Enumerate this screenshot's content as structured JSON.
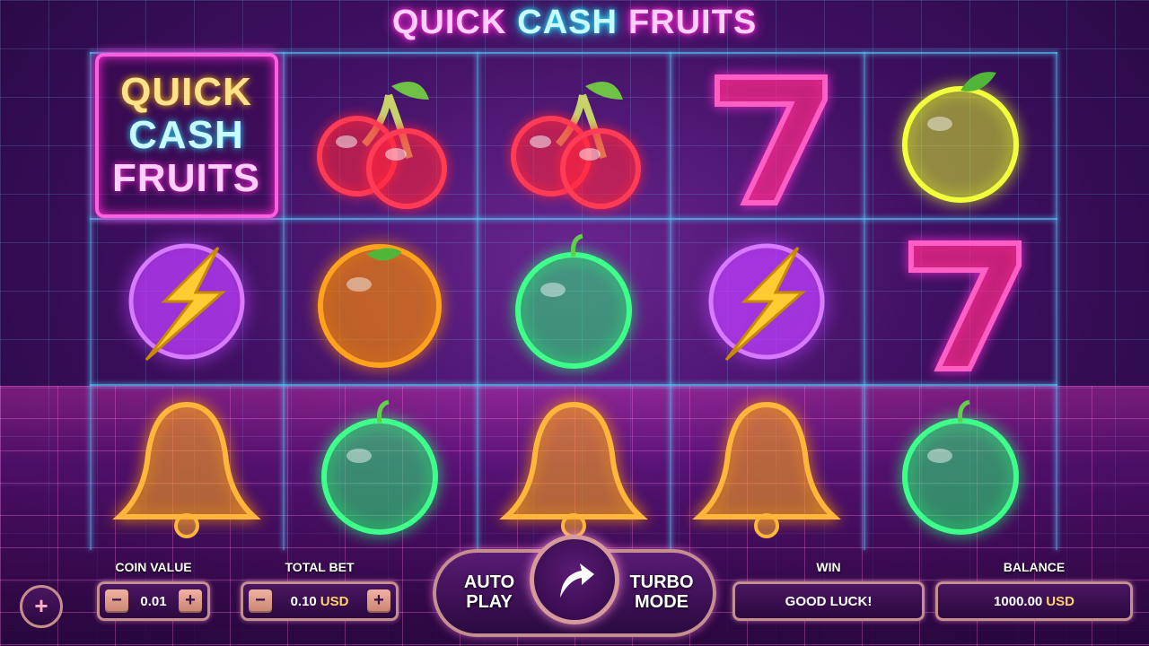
{
  "title": {
    "part1": "QUICK",
    "part2": "CASH",
    "part3": "FRUITS"
  },
  "logo": {
    "line1": "QUICK",
    "line2": "CASH",
    "line3": "FRUITS"
  },
  "reels": {
    "row1": [
      "logo",
      "cherry",
      "cherry",
      "seven",
      "lemon"
    ],
    "row2": [
      "lightning-orb",
      "orange",
      "apple",
      "lightning-orb",
      "seven"
    ],
    "row3": [
      "bell",
      "apple",
      "bell",
      "bell",
      "apple"
    ]
  },
  "controls": {
    "coin_value_label": "COIN VALUE",
    "coin_value": "0.01",
    "total_bet_label": "TOTAL BET",
    "total_bet": "0.10",
    "total_bet_currency": "USD",
    "minus": "−",
    "plus": "+",
    "auto_play": "AUTO PLAY",
    "turbo_mode": "TURBO MODE",
    "win_label": "WIN",
    "win_value": "GOOD LUCK!",
    "balance_label": "BALANCE",
    "balance_value": "1000.00",
    "balance_currency": "USD"
  },
  "colors": {
    "neon_pink": "#ff2ad4",
    "neon_cyan": "#20e0ff",
    "panel_border": "#c58f8f",
    "currency": "#ffd36a"
  }
}
